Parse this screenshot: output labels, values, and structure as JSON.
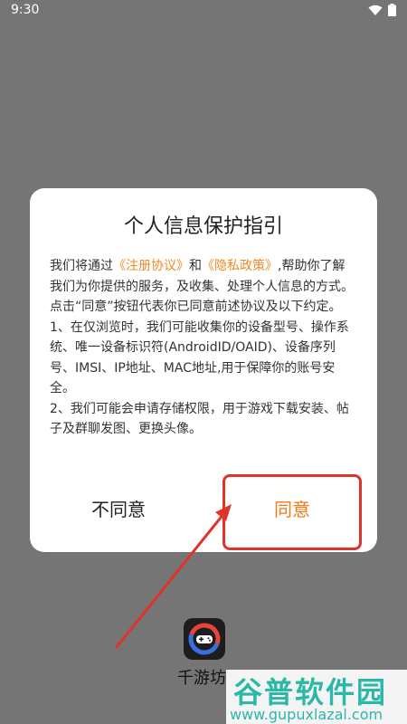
{
  "status_bar": {
    "time": "9:30",
    "icons": [
      "wifi-icon",
      "battery-icon"
    ]
  },
  "dialog": {
    "title": "个人信息保护指引",
    "body": {
      "p1_pre": "我们将通过",
      "p1_link1": "《注册协议》",
      "p1_mid": "和",
      "p1_link2": "《隐私政策》",
      "p1_post": ",帮助你了解我们为你提供的服务，及收集、处理个人信息的方式。",
      "p2": " 点击“同意”按钮代表你已同意前述协议及以下约定。",
      "p3": " 1、在仅浏览时，我们可能收集你的设备型号、操作系统、唯一设备标识符(AndroidID/OAID)、设备序列号、IMSI、IP地址、MAC地址,用于保障你的账号安全。",
      "p4": " 2、我们可能会申请存储权限，用于游戏下载安装、帖子及群聊发图、更换头像。"
    },
    "disagree_label": "不同意",
    "agree_label": "同意"
  },
  "app": {
    "label": "千游坊"
  },
  "watermark": {
    "title": "谷普软件园",
    "url": "www.gupuxlazal.com"
  },
  "colors": {
    "accent": "#f07a18",
    "annotation": "#e0342b",
    "overlay": "#757575"
  }
}
